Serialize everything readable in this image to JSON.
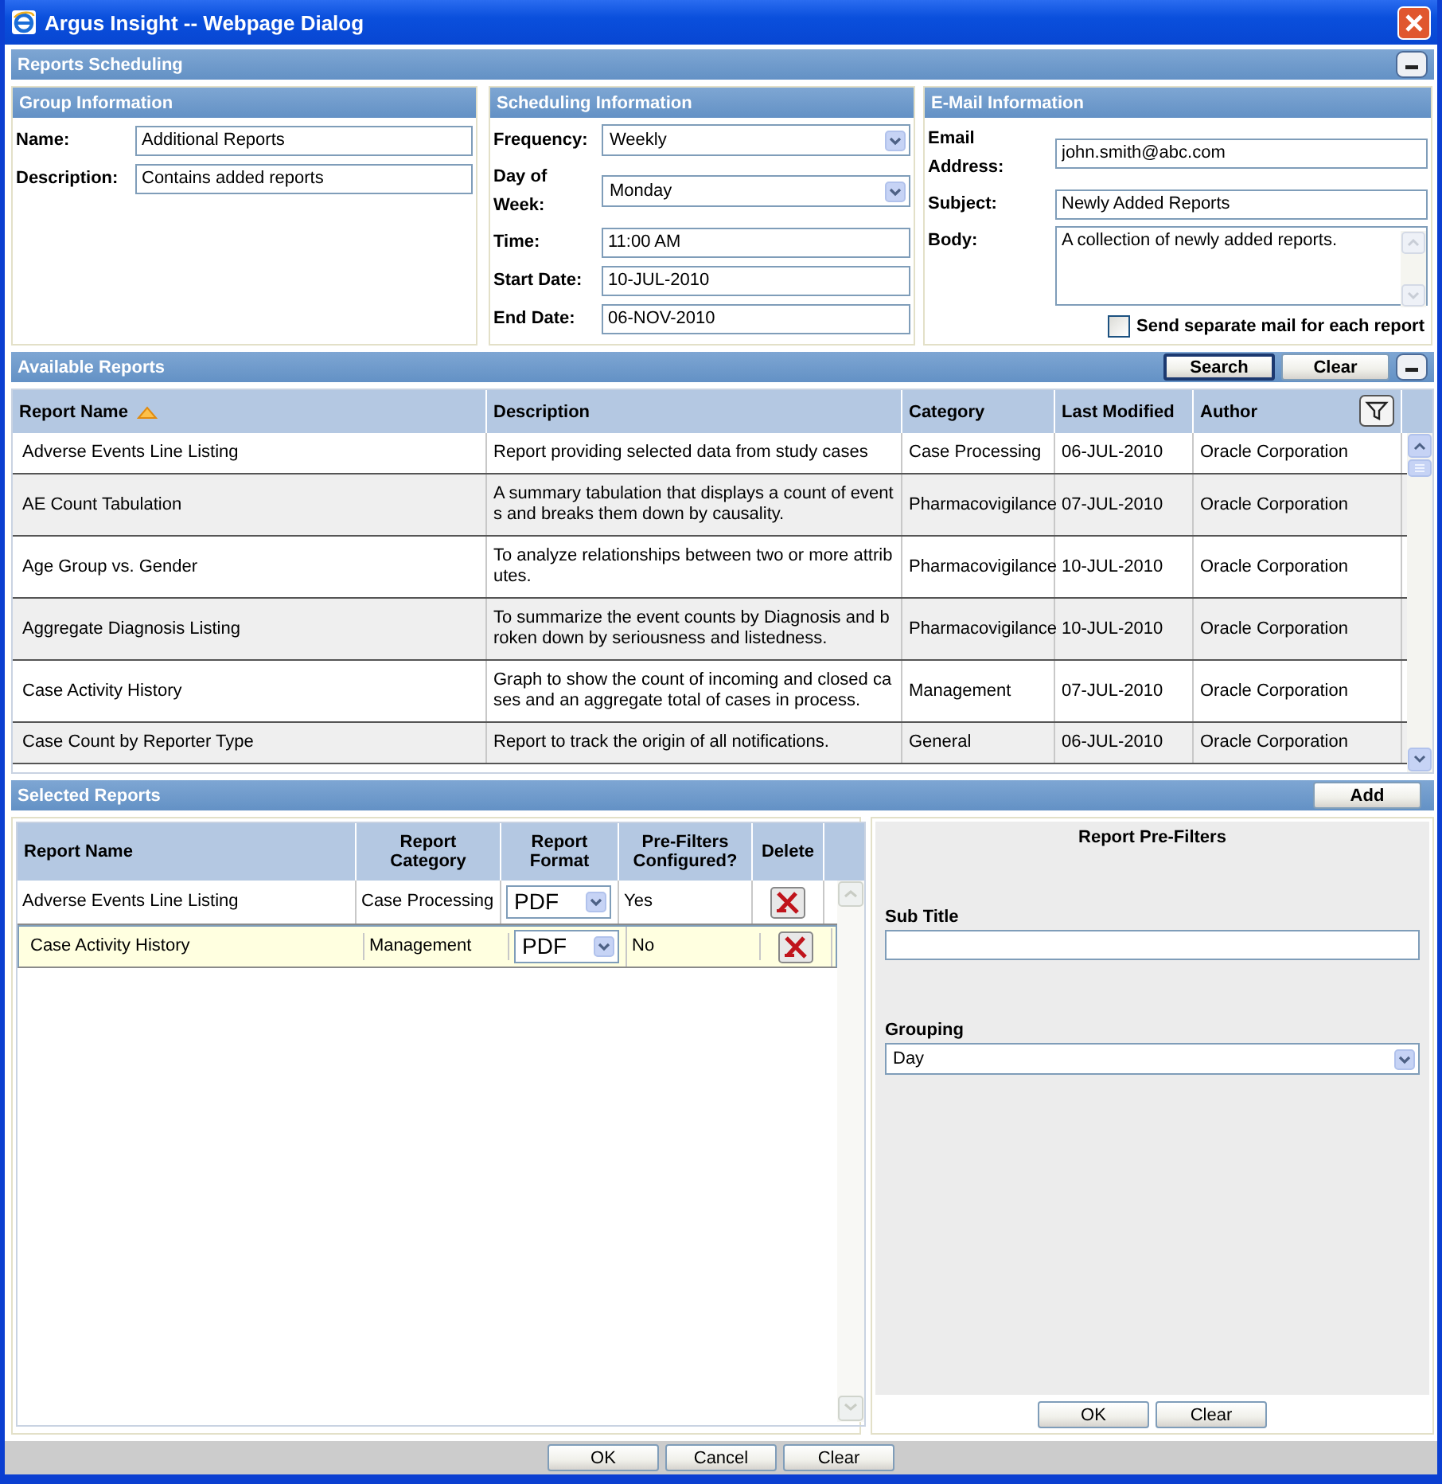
{
  "window": {
    "title": "Argus Insight -- Webpage Dialog"
  },
  "header": {
    "title": "Reports Scheduling"
  },
  "group_information": {
    "title": "Group Information",
    "fields": [
      {
        "kind": "text",
        "label": "Name:",
        "value": "Additional Reports"
      },
      {
        "kind": "text",
        "label": "Description:",
        "value": "Contains added reports"
      }
    ]
  },
  "scheduling_information": {
    "title": "Scheduling Information",
    "fields": [
      {
        "kind": "select",
        "label": "Frequency:",
        "value": "Weekly"
      },
      {
        "kind": "select",
        "label": "Day of Week:",
        "value": "Monday"
      },
      {
        "kind": "text",
        "label": "Time:",
        "value": "11:00 AM"
      },
      {
        "kind": "text",
        "label": "Start Date:",
        "value": "10-JUL-2010"
      },
      {
        "kind": "text",
        "label": "End Date:",
        "value": "06-NOV-2010"
      }
    ]
  },
  "email_information": {
    "title": "E-Mail Information",
    "fields": [
      {
        "kind": "text",
        "label": "Email Address:",
        "value": "john.smith@abc.com"
      },
      {
        "kind": "text",
        "label": "Subject:",
        "value": "Newly Added Reports"
      },
      {
        "kind": "textarea",
        "label": "Body:",
        "value": "A collection of newly added reports."
      }
    ],
    "separate_mail": {
      "label": "Send separate mail for each report",
      "checked": false
    }
  },
  "available_reports": {
    "title": "Available Reports",
    "buttons": [
      "Search",
      "Clear"
    ],
    "columns": [
      {
        "label": "Report Name",
        "sorted": true
      },
      {
        "label": "Description",
        "sorted": false
      },
      {
        "label": "Category",
        "sorted": false
      },
      {
        "label": "Last Modified",
        "sorted": false
      },
      {
        "label": "Author",
        "sorted": false
      }
    ],
    "rows": [
      [
        "Adverse Events Line Listing",
        "Report providing selected data from study cases",
        "Case Processing",
        "06-JUL-2010",
        "Oracle Corporation"
      ],
      [
        "AE Count Tabulation",
        "A summary tabulation that displays a count of events and breaks them down by causality.",
        "Pharmacovigilance",
        "07-JUL-2010",
        "Oracle Corporation"
      ],
      [
        "Age Group vs. Gender",
        "To analyze relationships between two or more attributes.",
        "Pharmacovigilance",
        "10-JUL-2010",
        "Oracle Corporation"
      ],
      [
        "Aggregate Diagnosis Listing",
        "To summarize the event counts by Diagnosis and broken down by seriousness and listedness.",
        "Pharmacovigilance",
        "10-JUL-2010",
        "Oracle Corporation"
      ],
      [
        "Case Activity History",
        "Graph to show the count of incoming and closed cases and an aggregate total of cases in process.",
        "Management",
        "07-JUL-2010",
        "Oracle Corporation"
      ],
      [
        "Case Count by Reporter Type",
        "Report to track the origin of all notifications.",
        "General",
        "06-JUL-2010",
        "Oracle Corporation"
      ]
    ]
  },
  "selected_reports": {
    "title": "Selected Reports",
    "add_button": "Add",
    "columns": [
      "Report Name",
      "Report Category",
      "Report Format",
      "Pre-Filters Configured?",
      "Delete"
    ],
    "rows": [
      {
        "name": "Adverse Events Line Listing",
        "category": "Case Processing",
        "format": "PDF",
        "configured": "Yes",
        "selected": false
      },
      {
        "name": "Case Activity History",
        "category": "Management",
        "format": "PDF",
        "configured": "No",
        "selected": true
      }
    ]
  },
  "pre_filters": {
    "title": "Report Pre-Filters",
    "fields": [
      {
        "kind": "text",
        "label": "Sub Title"
      },
      {
        "kind": "select",
        "label": "Grouping",
        "value": "Day"
      }
    ],
    "buttons": [
      "OK",
      "Clear"
    ]
  },
  "footer_buttons": [
    "OK",
    "Cancel",
    "Clear"
  ]
}
